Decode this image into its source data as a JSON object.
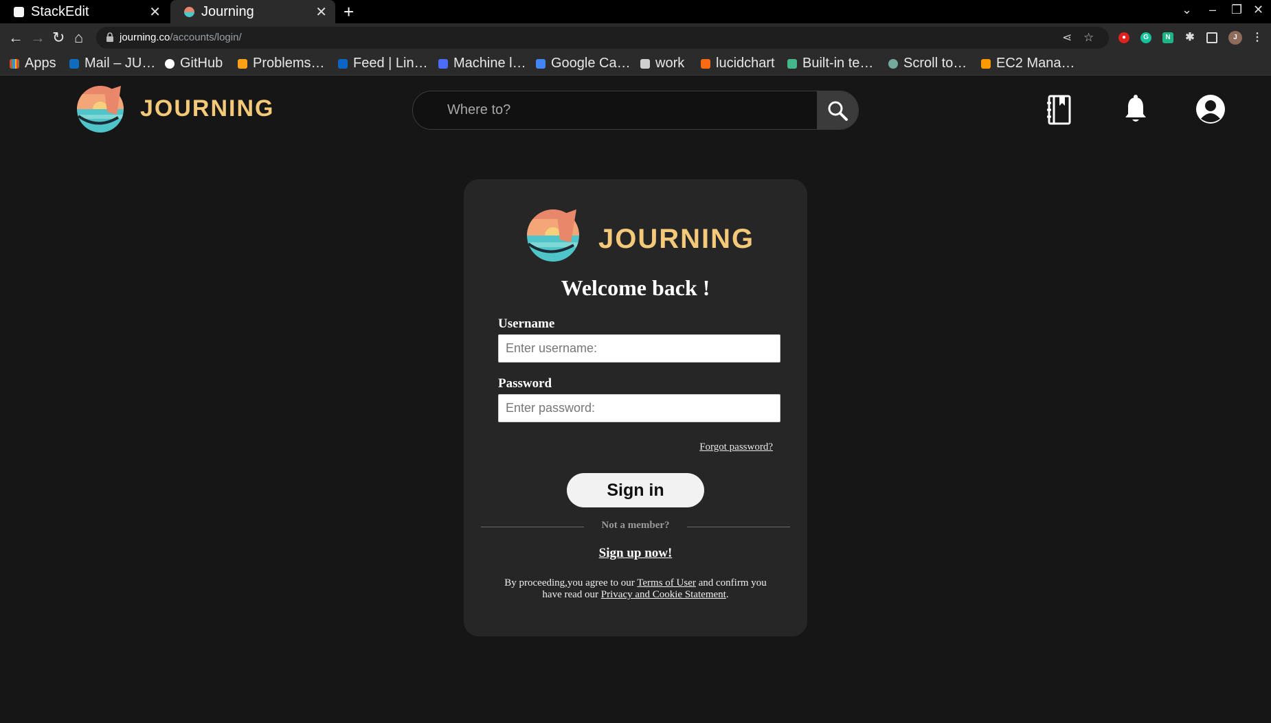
{
  "browser": {
    "tabs": [
      {
        "title": "StackEdit",
        "close": "✕"
      },
      {
        "title": "Journing",
        "close": "✕"
      }
    ],
    "new_tab": "+",
    "url_host": "journing.co",
    "url_path": "/accounts/login/",
    "bookmarks": [
      {
        "label": "Apps",
        "icon": "apps-grid-icon",
        "color": "#e94235"
      },
      {
        "label": "Mail – JU…",
        "icon": "outlook-icon",
        "color": "#0f6cbd"
      },
      {
        "label": "GitHub",
        "icon": "github-icon",
        "color": "#ffffff"
      },
      {
        "label": "Problems…",
        "icon": "leetcode-icon",
        "color": "#ffa116"
      },
      {
        "label": "Feed | Lin…",
        "icon": "linkedin-icon",
        "color": "#0a66c2"
      },
      {
        "label": "Machine l…",
        "icon": "arrow-icon",
        "color": "#4a6cf7"
      },
      {
        "label": "Google Ca…",
        "icon": "calendar-icon",
        "color": "#4285f4"
      },
      {
        "label": "work",
        "icon": "folder-icon",
        "color": "#d0d0d0"
      },
      {
        "label": "lucidchart",
        "icon": "lucidchart-icon",
        "color": "#f96b13"
      },
      {
        "label": "Built-in te…",
        "icon": "django-icon",
        "color": "#44b78b"
      },
      {
        "label": "Scroll to…",
        "icon": "openai-icon",
        "color": "#74aa9c"
      },
      {
        "label": "EC2 Mana…",
        "icon": "aws-icon",
        "color": "#ff9900"
      }
    ]
  },
  "header": {
    "brand": "JOURNING",
    "search_placeholder": "Where to?"
  },
  "login": {
    "brand": "JOURNING",
    "welcome": "Welcome back !",
    "username_label": "Username",
    "username_placeholder": "Enter username:",
    "password_label": "Password",
    "password_placeholder": "Enter password:",
    "forgot": "Forgot password?",
    "signin": "Sign in",
    "not_member": "Not a member?",
    "signup": "Sign up now!",
    "terms_pre": "By proceeding,you agree to our ",
    "terms_link": "Terms of User",
    "terms_mid": " and confirm you have read our ",
    "privacy_link": "Privacy and Cookie Statement",
    "terms_end": "."
  },
  "colors": {
    "page_bg": "#161616",
    "card_bg": "#262626",
    "brand_gold": "#f4c97a",
    "sunset_orange": "#e9876a",
    "sea_teal": "#4fc4c9"
  }
}
